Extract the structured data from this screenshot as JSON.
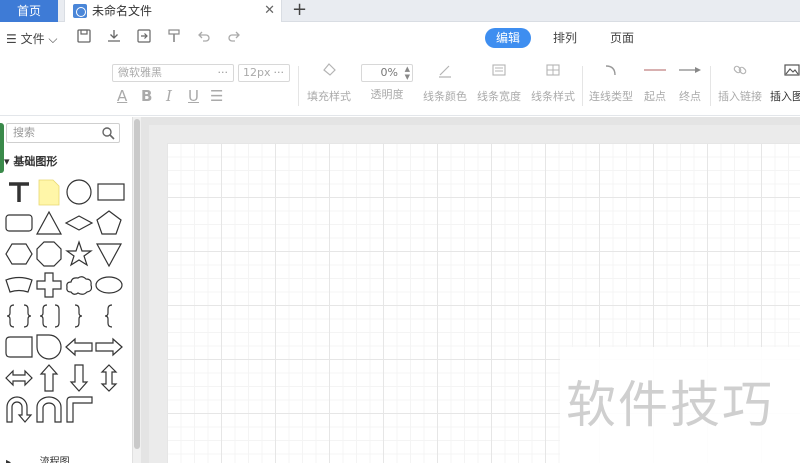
{
  "tabs": {
    "home_label": "首页",
    "doc_title": "未命名文件",
    "close_glyph": "✕",
    "add_glyph": "+"
  },
  "toolbar": {
    "file_label": "☰ 文件 ⌵",
    "modes": [
      "编辑",
      "排列",
      "页面"
    ],
    "active_mode": "编辑"
  },
  "format": {
    "font_family_placeholder": "微软雅黑",
    "font_size_placeholder": "12px",
    "opacity_value": "0%",
    "text_buttons": [
      "A",
      "B",
      "I",
      "U",
      "☰"
    ],
    "groups": [
      {
        "label": "填充样式",
        "icon": "fill-bucket-icon"
      },
      {
        "label": "透明度",
        "icon": "opacity-icon"
      },
      {
        "label": "线条颜色",
        "icon": "pen-icon"
      },
      {
        "label": "线条宽度",
        "icon": "line-width-icon"
      },
      {
        "label": "线条样式",
        "icon": "line-style-icon"
      },
      {
        "label": "连线类型",
        "icon": "connector-icon"
      },
      {
        "label": "起点",
        "icon": "start-point-icon"
      },
      {
        "label": "终点",
        "icon": "end-arrow-icon"
      },
      {
        "label": "插入链接",
        "icon": "link-icon"
      },
      {
        "label": "插入图",
        "icon": "image-icon"
      }
    ]
  },
  "shapes_panel": {
    "search_placeholder": "搜索",
    "section_title": "▾ 基础图形",
    "next_section": "▸ ... ... 流程图"
  },
  "watermark": "软件技巧",
  "colors": {
    "accent": "#3e8ef0",
    "home_tab": "#3e7bd6",
    "panel_tab": "#3a8a4a"
  }
}
